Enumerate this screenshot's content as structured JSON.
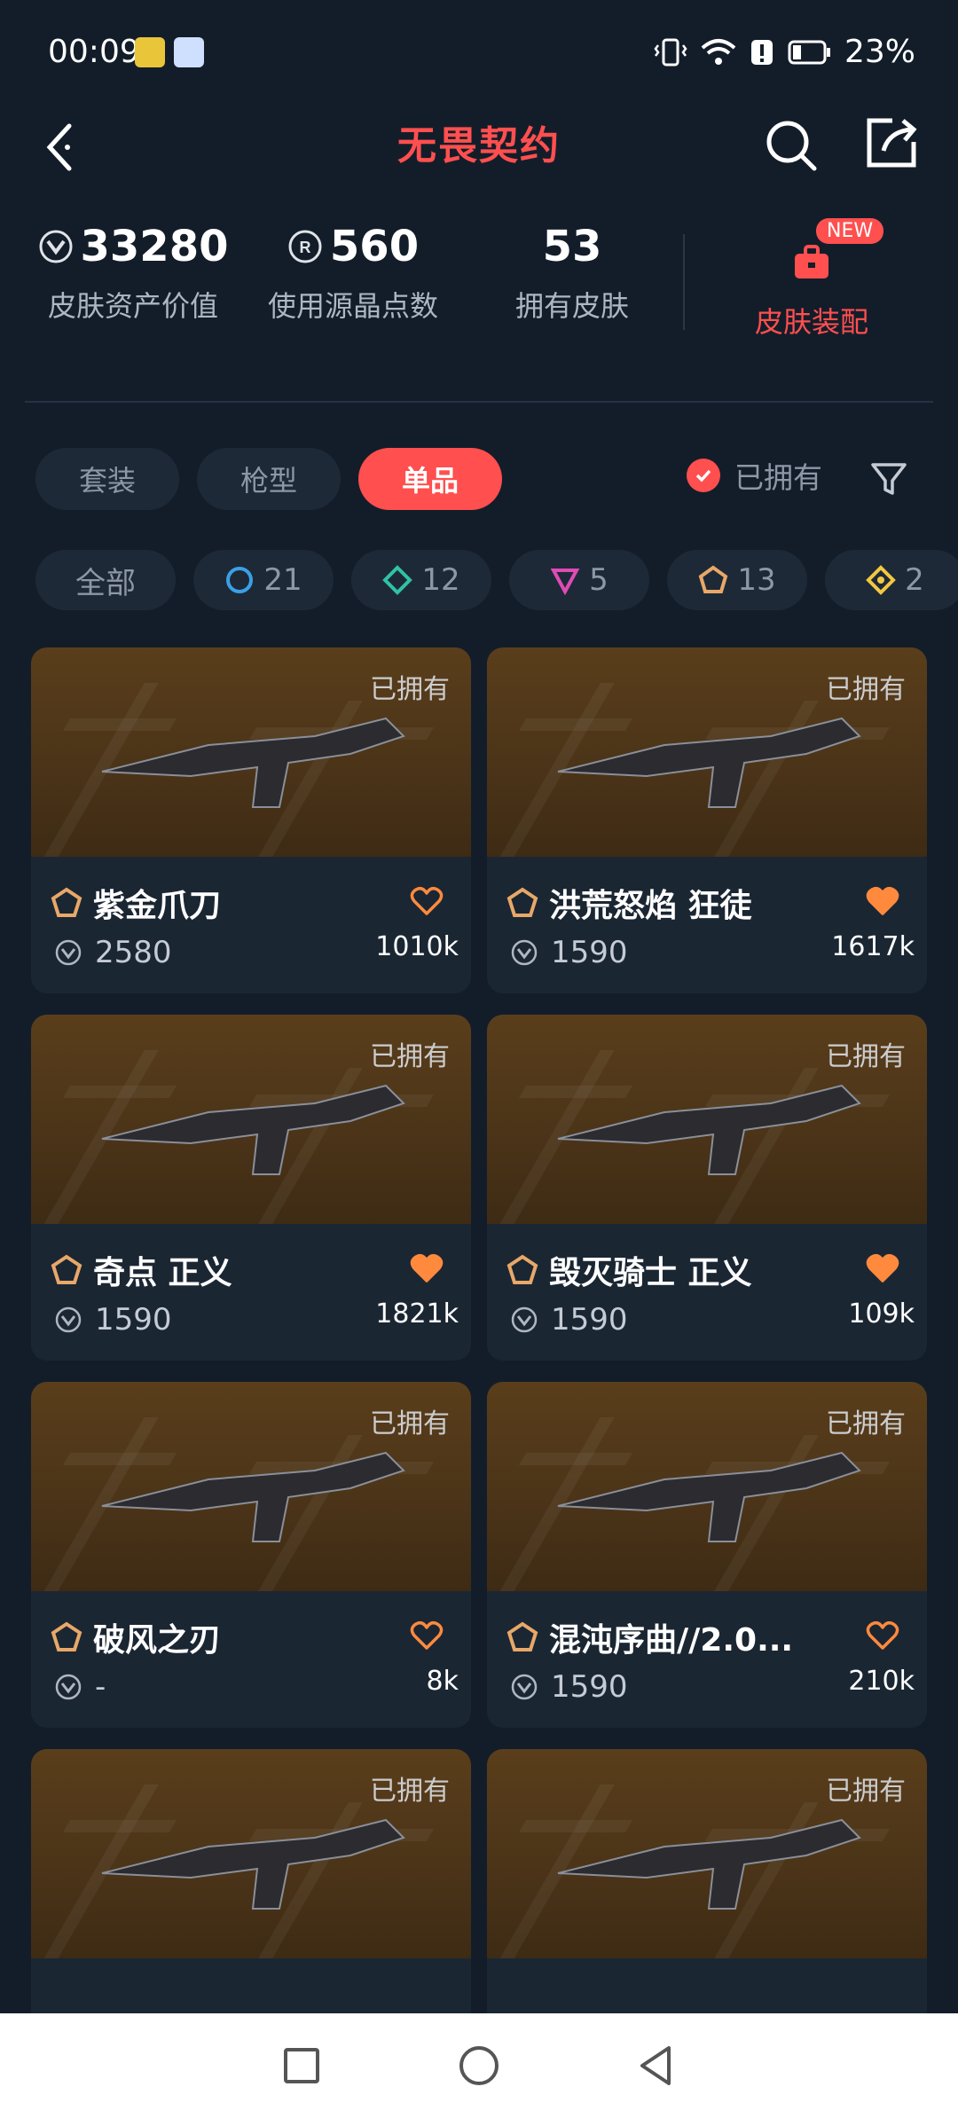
{
  "status": {
    "time": "00:09",
    "battery": "23%"
  },
  "header": {
    "title": "无畏契约"
  },
  "stats": [
    {
      "value": "33280",
      "label": "皮肤资产价值"
    },
    {
      "value": "560",
      "label": "使用源晶点数"
    },
    {
      "value": "53",
      "label": "拥有皮肤"
    }
  ],
  "equip": {
    "badge": "NEW",
    "label": "皮肤装配"
  },
  "tabs": [
    "套装",
    "枪型",
    "单品"
  ],
  "owned_filter": "已拥有",
  "chips": [
    {
      "label": "全部"
    },
    {
      "count": "21",
      "color": "#3aa0e6"
    },
    {
      "count": "12",
      "color": "#2fc2a6"
    },
    {
      "count": "5",
      "color": "#e04bb5"
    },
    {
      "count": "13",
      "color": "#e8a868"
    },
    {
      "count": "2",
      "color": "#f2c842"
    }
  ],
  "cards": [
    {
      "owned": "已拥有",
      "name": "紫金爪刀",
      "price": "2580",
      "likes": "1010k",
      "liked": false
    },
    {
      "owned": "已拥有",
      "name": "洪荒怒焰 狂徒",
      "price": "1590",
      "likes": "1617k",
      "liked": true
    },
    {
      "owned": "已拥有",
      "name": "奇点 正义",
      "price": "1590",
      "likes": "1821k",
      "liked": true
    },
    {
      "owned": "已拥有",
      "name": "毁灭骑士 正义",
      "price": "1590",
      "likes": "109k",
      "liked": true
    },
    {
      "owned": "已拥有",
      "name": "破风之刃",
      "price": "-",
      "likes": "8k",
      "liked": false
    },
    {
      "owned": "已拥有",
      "name": "混沌序曲//2.0...",
      "price": "1590",
      "likes": "210k",
      "liked": false
    },
    {
      "owned": "已拥有",
      "name": "",
      "price": "",
      "likes": "",
      "liked": false
    },
    {
      "owned": "已拥有",
      "name": "",
      "price": "",
      "likes": "",
      "liked": false
    }
  ],
  "colors": {
    "accent": "#ff4f4f",
    "background": "#131d2a",
    "heart": "#ff8a3d"
  }
}
